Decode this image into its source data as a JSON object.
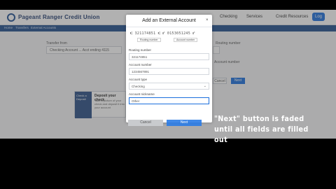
{
  "header": {
    "brand": "Pageant Ranger Credit Union",
    "nav": [
      "Checking",
      "Services",
      "Credit Resources"
    ],
    "help_label": "Log"
  },
  "subnav": {
    "items": [
      "Home",
      "Transfers",
      "External Accounts"
    ]
  },
  "form": {
    "account_label": "Transfer from",
    "account_value": "Checking Account ... Acct ending 4115",
    "side_label": "Routing number",
    "side_hint": "Account number"
  },
  "buttons": {
    "cancel": "Cancel",
    "continue": "Next"
  },
  "card": {
    "side": "Check a Deposit",
    "title": "Deposit your check",
    "text": "Take a picture of your check and deposit it into your account"
  },
  "modal": {
    "title": "Add an External Account",
    "close": "×",
    "check_numbers": "⑆ 321174851 ⑆  ⑈ 0153051245 ⑈",
    "routing_tag": "Routing number",
    "account_tag": "Account number",
    "fields": [
      {
        "label": "Routing number",
        "value": "321174851"
      },
      {
        "label": "Account number",
        "value": "1234567891"
      },
      {
        "label": "Account type",
        "value": "Checking"
      },
      {
        "label": "Account nickname",
        "value": "Other"
      }
    ],
    "cancel": "Cancel",
    "next": "Next"
  },
  "caption": "\"Next\" button is faded until all fields are filled out",
  "colors": {
    "primary": "#1a6fdc",
    "navy": "#1f4e8c"
  }
}
